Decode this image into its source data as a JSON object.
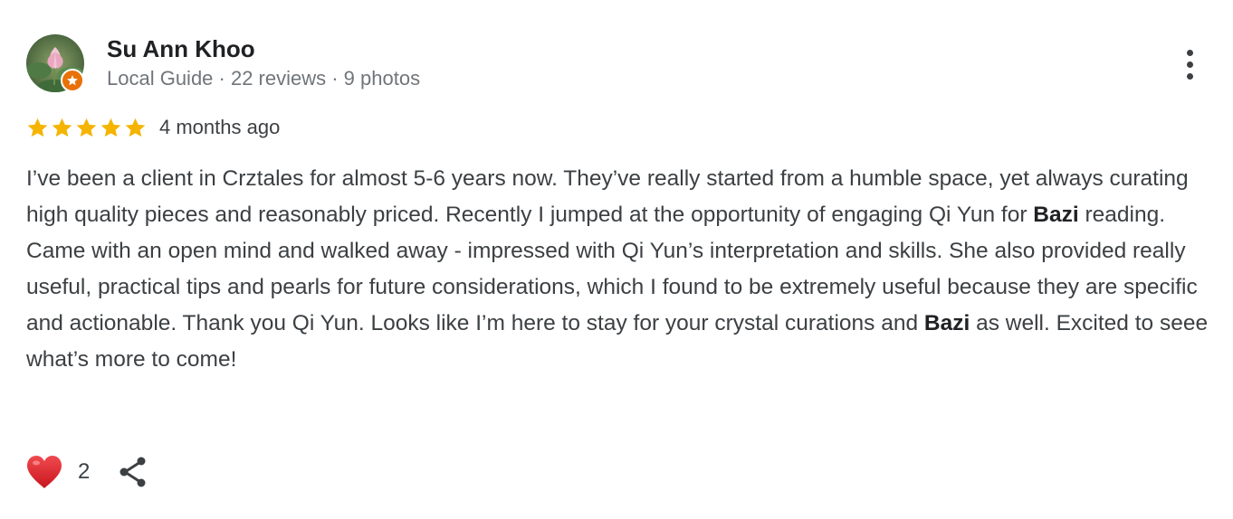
{
  "reviewer": {
    "name": "Su Ann Khoo",
    "meta": "Local Guide · 22 reviews · 9 photos"
  },
  "rating": {
    "stars": 5,
    "max": 5,
    "date": "4 months ago"
  },
  "review": {
    "p1": "I’ve been a client in Crztales for almost 5-6 years now. They’ve really started from a humble space, yet always curating high quality pieces and reasonably priced. Recently I jumped at the opportunity of engaging Qi Yun for ",
    "bold1": "Bazi",
    "p2": " reading. Came with an open mind and walked away - impressed with Qi Yun’s interpretation and skills. She also provided really useful, practical tips and pearls for future considerations, which I found to be extremely useful because they are specific and actionable. Thank you Qi Yun. Looks like I’m here to stay for your crystal curations and ",
    "bold2": "Bazi",
    "p3": " as well. Excited to seee what’s more to come!"
  },
  "actions": {
    "like_count": "2",
    "like_icon": "heart-icon",
    "share_icon": "share-icon",
    "more_icon": "more-vert-icon"
  },
  "colors": {
    "star": "#f4b400",
    "heart": "#e0242a",
    "badge": "#e8710a",
    "meta_text": "#70757a"
  }
}
